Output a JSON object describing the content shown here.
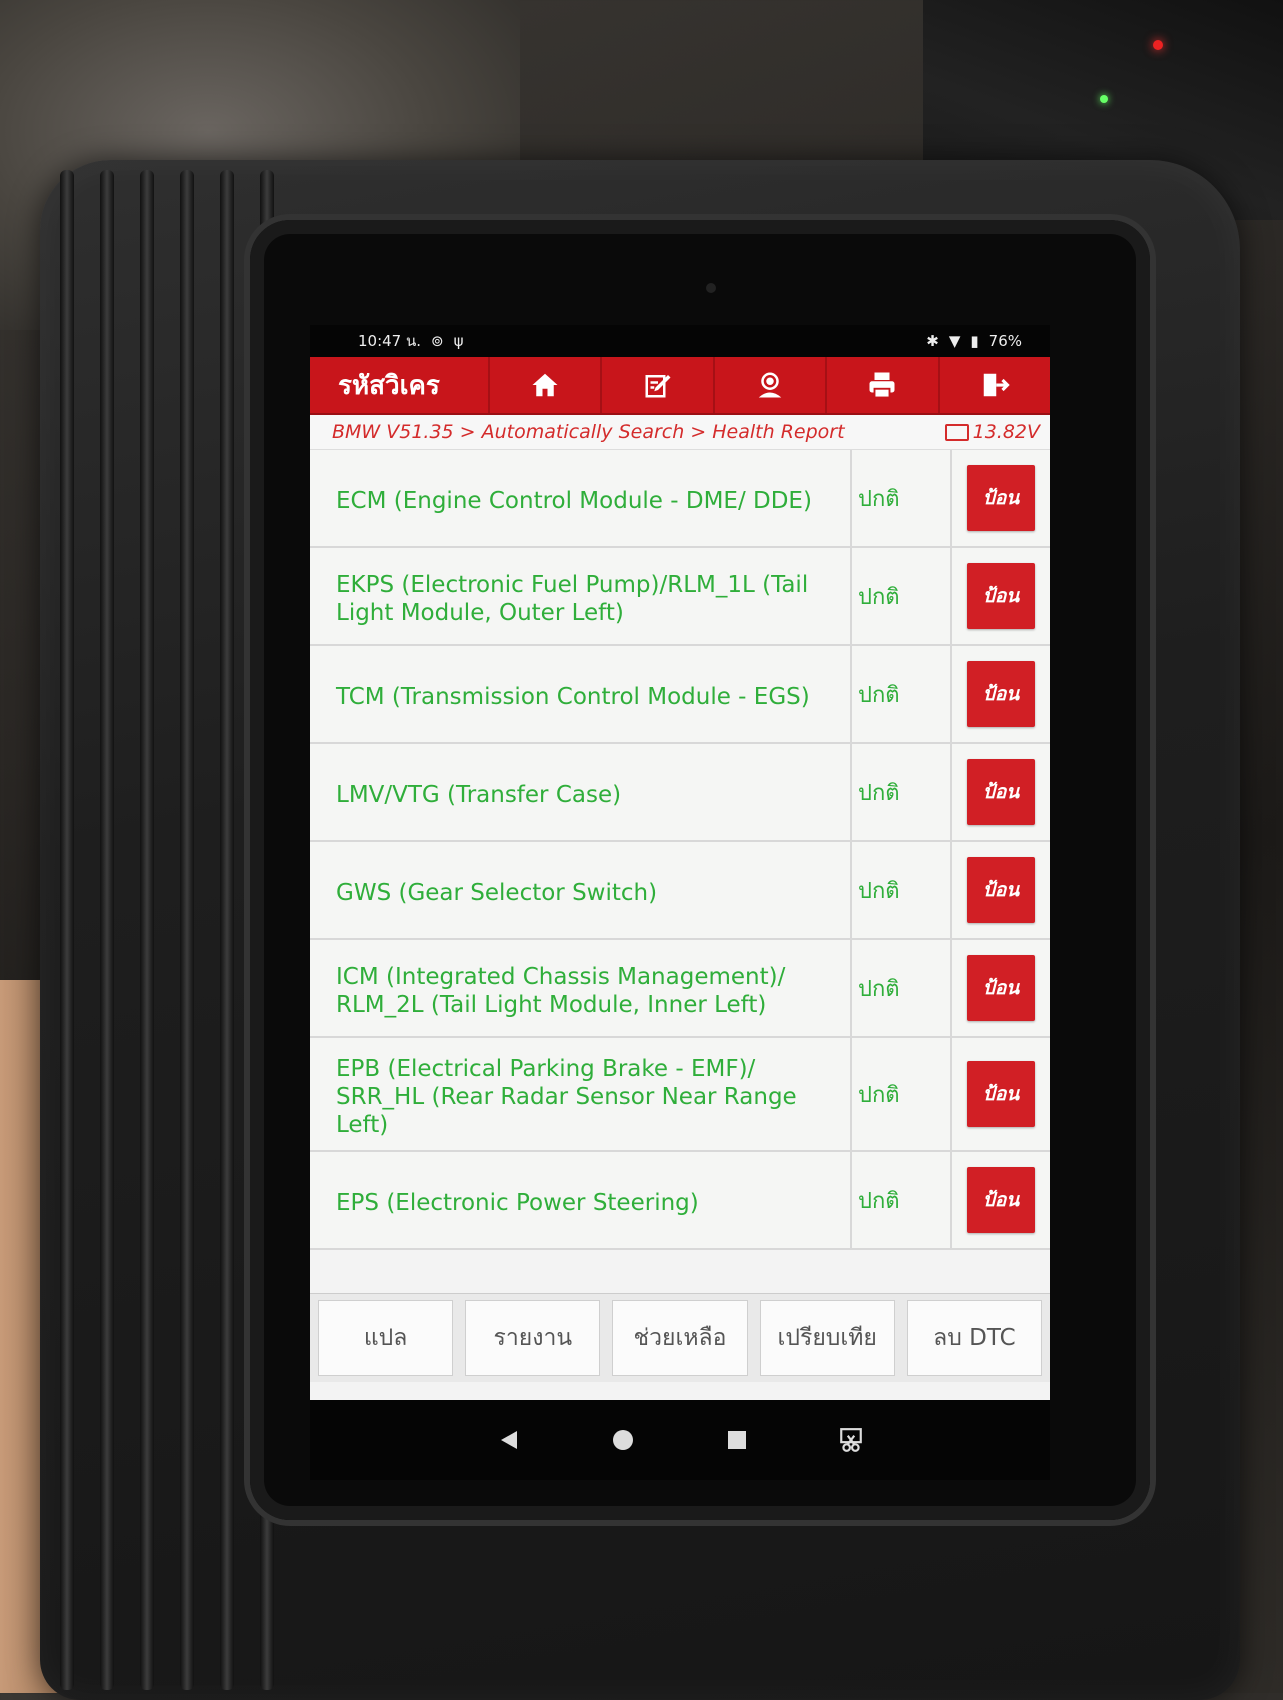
{
  "statusbar": {
    "time": "10:47 น.",
    "battery_percent": "76%"
  },
  "toolbar": {
    "title": "รหัสวิเคร",
    "buttons": [
      {
        "icon": "home-icon"
      },
      {
        "icon": "edit-icon"
      },
      {
        "icon": "user-icon"
      },
      {
        "icon": "print-icon"
      },
      {
        "icon": "exit-icon"
      }
    ]
  },
  "breadcrumb": {
    "path": "BMW V51.35 > Automatically Search > Health Report",
    "voltage": "13.82V"
  },
  "modules": [
    {
      "name": "ECM (Engine Control Module - DME/ DDE)",
      "status": "ปกติ",
      "action": "ป้อน"
    },
    {
      "name": "EKPS (Electronic Fuel Pump)/RLM_1L (Tail Light Module, Outer Left)",
      "status": "ปกติ",
      "action": "ป้อน"
    },
    {
      "name": "TCM (Transmission Control Module - EGS)",
      "status": "ปกติ",
      "action": "ป้อน"
    },
    {
      "name": "LMV/VTG (Transfer Case)",
      "status": "ปกติ",
      "action": "ป้อน"
    },
    {
      "name": "GWS (Gear Selector Switch)",
      "status": "ปกติ",
      "action": "ป้อน"
    },
    {
      "name": "ICM (Integrated Chassis Management)/ RLM_2L (Tail Light Module, Inner Left)",
      "status": "ปกติ",
      "action": "ป้อน"
    },
    {
      "name": "EPB (Electrical Parking Brake - EMF)/ SRR_HL (Rear Radar Sensor Near Range Left)",
      "status": "ปกติ",
      "action": "ป้อน"
    },
    {
      "name": "EPS (Electronic Power Steering)",
      "status": "ปกติ",
      "action": "ป้อน"
    }
  ],
  "bottombar": {
    "translate": "แปล",
    "report": "รายงาน",
    "help": "ช่วยเหลือ",
    "compare": "เปรียบเทีย",
    "clear_dtc": "ลบ DTC"
  },
  "colors": {
    "accent": "#c8151b",
    "module_text": "#2fae3a",
    "breadcrumb_text": "#d42b2b"
  }
}
